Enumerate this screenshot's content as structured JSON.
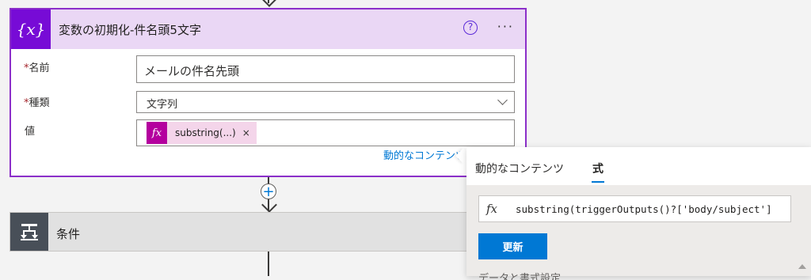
{
  "variable_card": {
    "title": "変数の初期化-件名頭5文字",
    "icon_text": "{x}",
    "help_icon": "?",
    "more_icon": "···",
    "fields": {
      "name": {
        "label": "名前",
        "required": "*",
        "value": "メールの件名先頭"
      },
      "type": {
        "label": "種類",
        "required": "*",
        "value": "文字列"
      },
      "value": {
        "label": "値",
        "token_label": "substring(...)",
        "token_icon": "fx",
        "token_remove": "×"
      }
    },
    "dynamic_link": "動的なコンテンツ"
  },
  "connector": {
    "add_label": "+"
  },
  "condition_card": {
    "title": "条件"
  },
  "popup": {
    "tabs": [
      {
        "label": "動的なコンテンツ",
        "active": false
      },
      {
        "label": "式",
        "active": true
      }
    ],
    "fx_icon": "fx",
    "expression": "substring(triggerOutputs()?['body/subject']",
    "update_label": "更新",
    "cutoff_text": "データと書式設定"
  },
  "colors": {
    "variable_accent": "#770bd6",
    "variable_header_bg": "#ead7f5",
    "token_accent": "#b4009e",
    "primary": "#0078d4",
    "condition_icon_bg": "#484f58"
  }
}
